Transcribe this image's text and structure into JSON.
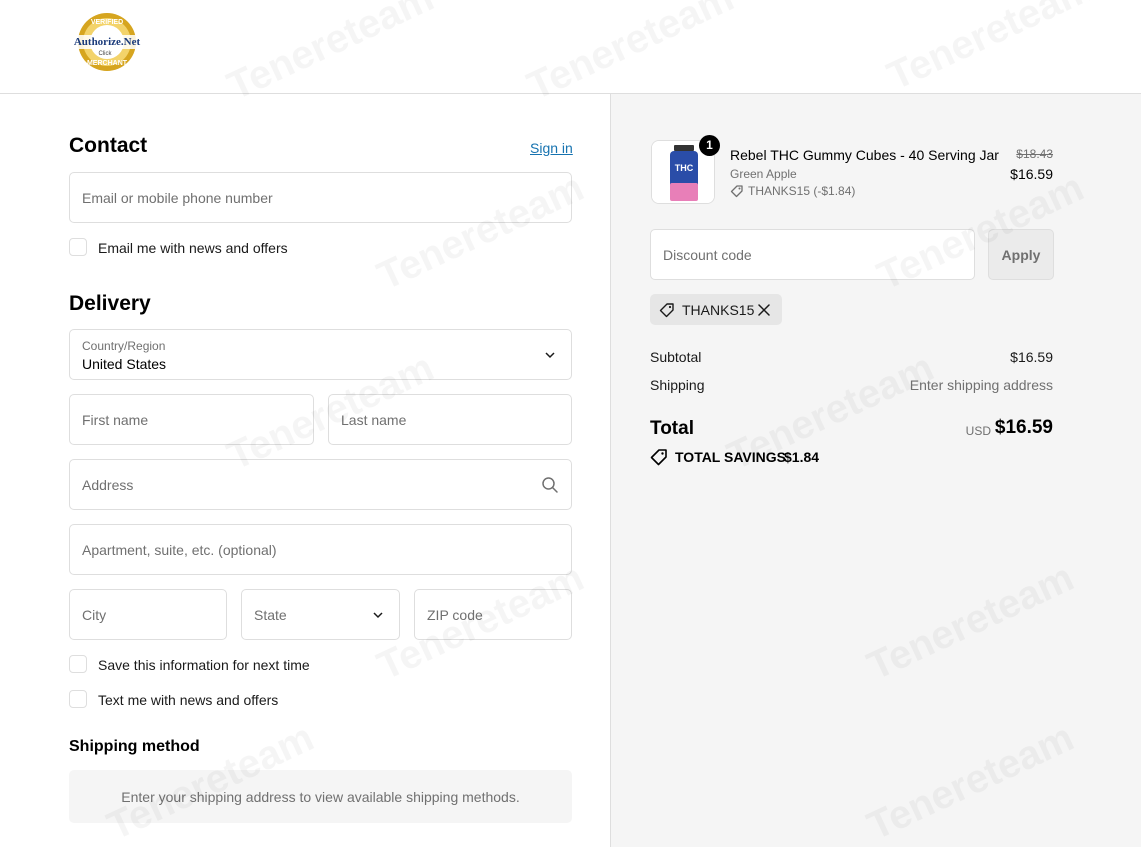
{
  "brand": {
    "logo_line1": "VERIFIED",
    "logo_line2": "Authorize.Net",
    "logo_line3": "Click",
    "logo_line4": "MERCHANT"
  },
  "contact": {
    "title": "Contact",
    "sign_in_label": "Sign in",
    "email_placeholder": "Email or mobile phone number",
    "email_opt_in_label": "Email me with news and offers"
  },
  "delivery": {
    "title": "Delivery",
    "country_label": "Country/Region",
    "country_value": "United States",
    "first_name_placeholder": "First name",
    "last_name_placeholder": "Last name",
    "address_placeholder": "Address",
    "apartment_placeholder": "Apartment, suite, etc. (optional)",
    "city_placeholder": "City",
    "state_placeholder": "State",
    "zip_placeholder": "ZIP code",
    "save_info_label": "Save this information for next time",
    "text_opt_in_label": "Text me with news and offers"
  },
  "shipping_method": {
    "title": "Shipping method",
    "message": "Enter your shipping address to view available shipping methods."
  },
  "order_summary": {
    "item": {
      "quantity": "1",
      "name": "Rebel THC Gummy Cubes - 40 Serving Jar",
      "variant": "Green Apple",
      "discount": "THANKS15 (-$1.84)",
      "original_price": "$18.43",
      "price": "$16.59",
      "thumb_text": "THC"
    },
    "discount_placeholder": "Discount code",
    "apply_label": "Apply",
    "applied_code": "THANKS15",
    "subtotal_label": "Subtotal",
    "subtotal_value": "$16.59",
    "shipping_label": "Shipping",
    "shipping_value": "Enter shipping address",
    "total_label": "Total",
    "total_currency": "USD",
    "total_value": "$16.59",
    "savings_label": "TOTAL SAVINGS",
    "savings_value": "$1.84"
  },
  "watermark_text": "Tenereteam",
  "colors": {
    "link": "#1773b0",
    "summary_bg": "#f5f5f5",
    "border": "#dedede",
    "logo_gold": "#d6a51f"
  }
}
